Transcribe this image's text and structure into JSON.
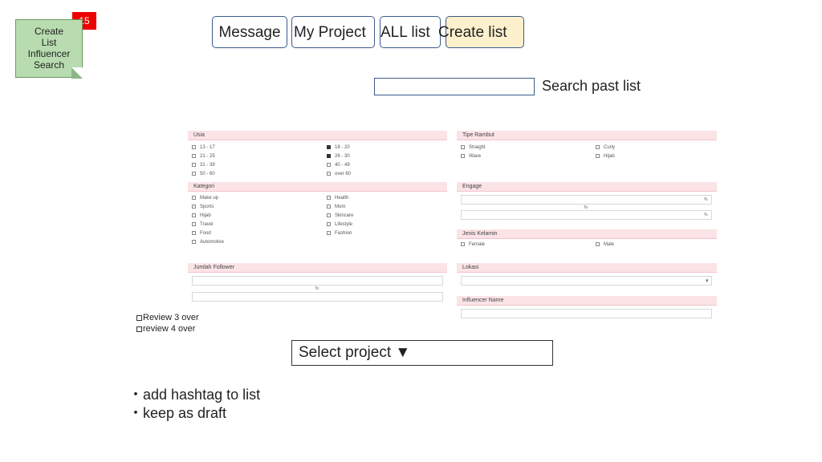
{
  "slide_number": "15",
  "note": {
    "lines": [
      "Create",
      "List",
      "Influencer",
      "Search"
    ]
  },
  "nav": {
    "message": "Message",
    "my_project": "My Project",
    "all_list": "ALL list",
    "create_list": "Create list"
  },
  "search": {
    "label": "Search past list",
    "value": ""
  },
  "form": {
    "usia": {
      "title": "Usia",
      "options": [
        {
          "label": "13 - 17",
          "checked": false
        },
        {
          "label": "18 - 20",
          "checked": true
        },
        {
          "label": "21 - 25",
          "checked": false
        },
        {
          "label": "26 - 30",
          "checked": true
        },
        {
          "label": "31 - 39",
          "checked": false
        },
        {
          "label": "40 - 49",
          "checked": false
        },
        {
          "label": "50 - 60",
          "checked": false
        },
        {
          "label": "over 60",
          "checked": false
        }
      ]
    },
    "tipe_rambut": {
      "title": "Tipe Rambut",
      "options": [
        "Straight",
        "Curly",
        "Wave",
        "Hijab"
      ]
    },
    "kategori": {
      "title": "Kategori",
      "options": [
        "Make up",
        "Health",
        "Sports",
        "Mom",
        "Hijab",
        "Skincare",
        "Travel",
        "Lifestyle",
        "Food",
        "Fashion",
        "Automotive"
      ]
    },
    "engage": {
      "title": "Engage",
      "unit": "%",
      "to": "To"
    },
    "jenis_kelamin": {
      "title": "Jenis Kelamin",
      "options": [
        "Female",
        "Male"
      ]
    },
    "jumlah_follower": {
      "title": "Jumlah Follower",
      "to": "To"
    },
    "lokasi": {
      "title": "Lokasi",
      "caret": "▾"
    },
    "influencer_name": {
      "title": "Influencer Name"
    }
  },
  "review": {
    "line1": "Review 3 over",
    "line2": "review 4 over"
  },
  "select_project": "Select project ▼",
  "bullets": [
    "・add hashtag to list",
    "・keep as draft"
  ]
}
